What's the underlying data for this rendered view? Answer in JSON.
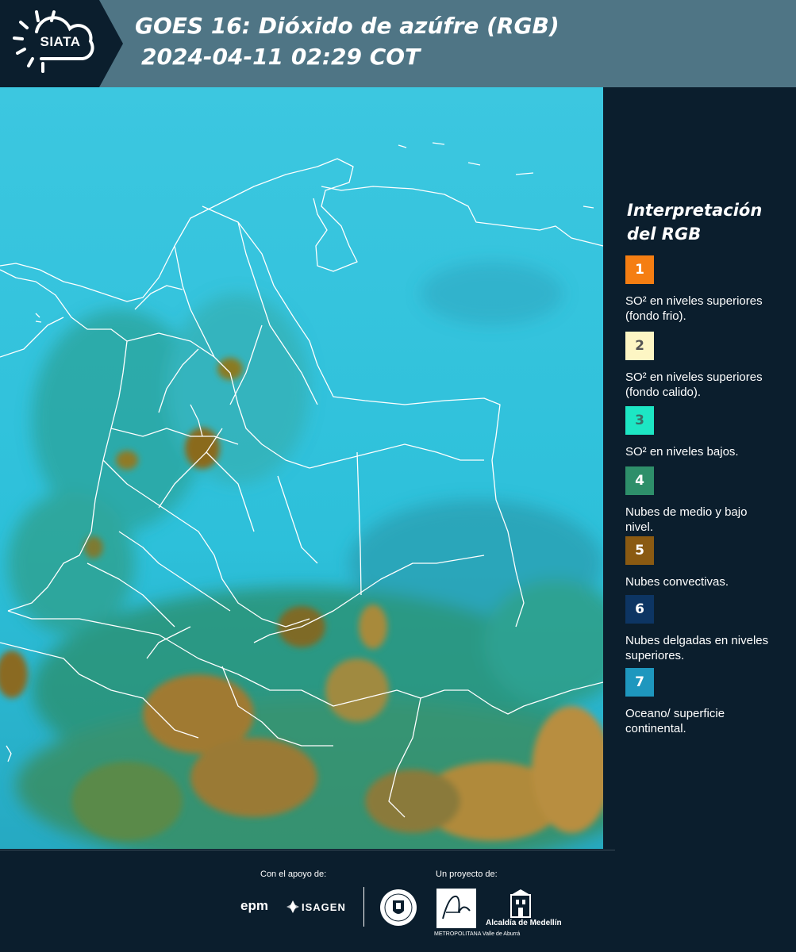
{
  "header": {
    "logo_text": "SIATA",
    "title_line1": "GOES 16: Dióxido de azúfre (RGB)",
    "title_line2": "2024-04-11 02:29 COT"
  },
  "colors": {
    "header_bg": "#4f7585",
    "panel_bg": "#0b1e2d",
    "map_base": "#2ec4dc",
    "border_lines": "#ffffff"
  },
  "legend": {
    "title": "Interpretación del RGB",
    "items": [
      {
        "number": "1",
        "color": "#f57e12",
        "text_color": "#ffffff",
        "label": "SO² en niveles superiores (fondo frio)."
      },
      {
        "number": "2",
        "color": "#fdf6c4",
        "text_color": "#555555",
        "label": "SO² en niveles superiores (fondo calido)."
      },
      {
        "number": "3",
        "color": "#1de6c4",
        "text_color": "#3a6d66",
        "label": "SO² en niveles bajos."
      },
      {
        "number": "4",
        "color": "#2e8f6a",
        "text_color": "#ffffff",
        "label": "Nubes de medio y bajo nivel."
      },
      {
        "number": "5",
        "color": "#8a5a12",
        "text_color": "#ffffff",
        "label": "Nubes convectivas."
      },
      {
        "number": "6",
        "color": "#0d3563",
        "text_color": "#ffffff",
        "label": "Nubes delgadas en niveles superiores."
      },
      {
        "number": "7",
        "color": "#1e97be",
        "text_color": "#ffffff",
        "label": "Oceano/ superficie continental."
      }
    ]
  },
  "footer": {
    "support_label": "Con el apoyo de:",
    "project_label": "Un proyecto de:",
    "sponsors": [
      "epm",
      "ISAGEN"
    ],
    "partners": [
      "Área Metropolitana Valle de Aburrá",
      "Alcaldía de Medellín"
    ],
    "area_caption": "METROPOLITANA Valle de Aburrá",
    "alcaldia_caption": "Alcaldía de Medellín"
  },
  "icons": [
    "siata-sun-cloud-icon",
    "isagen-icon",
    "medellin-seal-icon",
    "area-metropolitana-icon",
    "alcaldia-building-icon"
  ]
}
